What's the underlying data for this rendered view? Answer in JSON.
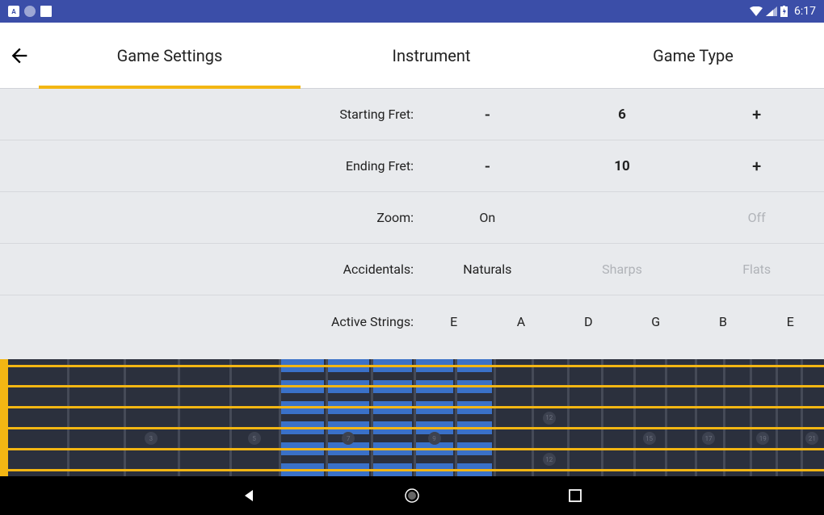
{
  "status": {
    "time": "6:17"
  },
  "tabs": {
    "active_index": 0,
    "items": [
      "Game Settings",
      "Instrument",
      "Game Type"
    ]
  },
  "settings": {
    "starting_fret": {
      "label": "Starting Fret:",
      "value": "6",
      "minus": "-",
      "plus": "+"
    },
    "ending_fret": {
      "label": "Ending Fret:",
      "value": "10",
      "minus": "-",
      "plus": "+"
    },
    "zoom": {
      "label": "Zoom:",
      "options": [
        "On",
        "Off"
      ],
      "selected": 0
    },
    "accidentals": {
      "label": "Accidentals:",
      "options": [
        "Naturals",
        "Sharps",
        "Flats"
      ],
      "selected": 0
    },
    "active_strings": {
      "label": "Active Strings:",
      "options": [
        "E",
        "A",
        "D",
        "G",
        "B",
        "E"
      ]
    }
  },
  "fretboard": {
    "strings": 6,
    "markers": [
      {
        "fret": 3,
        "label": "3",
        "row": 3
      },
      {
        "fret": 5,
        "label": "5",
        "row": 3
      },
      {
        "fret": 7,
        "label": "7",
        "row": 3
      },
      {
        "fret": 9,
        "label": "9",
        "row": 3
      },
      {
        "fret": 12,
        "label": "12",
        "row": 2
      },
      {
        "fret": 12,
        "label": "12",
        "row": 4
      },
      {
        "fret": 15,
        "label": "15",
        "row": 3
      },
      {
        "fret": 17,
        "label": "17",
        "row": 3
      },
      {
        "fret": 19,
        "label": "19",
        "row": 3
      },
      {
        "fret": 21,
        "label": "21",
        "row": 3
      }
    ],
    "highlight_start": 6,
    "highlight_end": 10
  }
}
